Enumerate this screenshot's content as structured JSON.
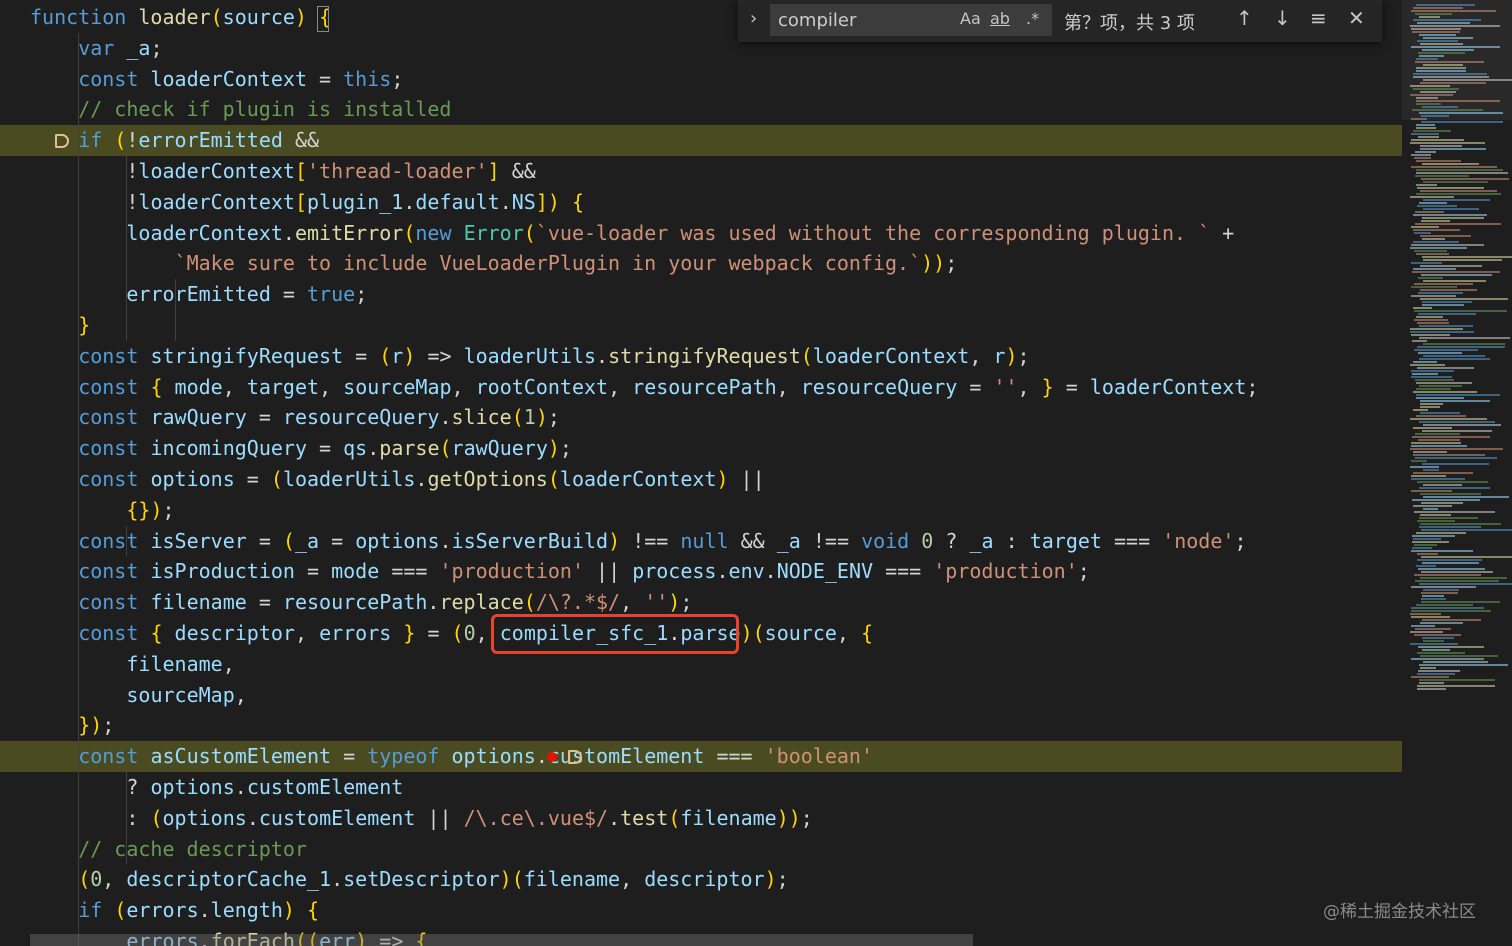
{
  "find_widget": {
    "query": "compiler",
    "match_case_label": "Aa",
    "whole_word_label": "ab",
    "regex_label": ".*",
    "result_count": "第？项，共 3 项",
    "icons": [
      "chevron-right-icon",
      "arrow-up-icon",
      "arrow-down-icon",
      "find-in-selection-icon",
      "close-icon"
    ]
  },
  "watermark": "@稀土掘金技术社区",
  "code_lines": [
    "function loader(source) {",
    "    var _a;",
    "    const loaderContext = this;",
    "    // check if plugin is installed",
    "    if (!errorEmitted &&",
    "        !loaderContext['thread-loader'] &&",
    "        !loaderContext[plugin_1.default.NS]) {",
    "        loaderContext.emitError(new Error(`vue-loader was used without the corresponding plugin. ` +",
    "            `Make sure to include VueLoaderPlugin in your webpack config.`));",
    "        errorEmitted = true;",
    "    }",
    "    const stringifyRequest = (r) => loaderUtils.stringifyRequest(loaderContext, r);",
    "    const { mode, target, sourceMap, rootContext, resourcePath, resourceQuery = '', } = loaderContext;",
    "    const rawQuery = resourceQuery.slice(1);",
    "    const incomingQuery = qs.parse(rawQuery);",
    "    const options = (loaderUtils.getOptions(loaderContext) ||",
    "        {});",
    "    const isServer = (_a = options.isServerBuild) !== null && _a !== void 0 ? _a : target === 'node';",
    "    const isProduction = mode === 'production' || process.env.NODE_ENV === 'production';",
    "    const filename = resourcePath.replace(/\\?.*$/, '');",
    "    const { descriptor, errors } = (0, compiler_sfc_1.parse)(source, {",
    "        filename,",
    "        sourceMap,",
    "    });",
    "    const asCustomElement = typeof options.customElement === 'boolean'",
    "        ? options.customElement",
    "        : (options.customElement || /\\.ce\\.vue$/.test(filename));",
    "    // cache descriptor",
    "    (0, descriptorCache_1.setDescriptor)(filename, descriptor);",
    "    if (errors.length) {",
    "        errors.forEach((err) => {"
  ],
  "colors": {
    "background": "#1e1e1e",
    "keyword": "#569cd6",
    "variable": "#9cdcfe",
    "function": "#dcdcaa",
    "string": "#ce9178",
    "comment": "#6a9955",
    "number": "#b5cea8",
    "highlight_line": "#4b4b21",
    "breakpoint": "#e51400",
    "annotation_box": "#e8432e"
  }
}
